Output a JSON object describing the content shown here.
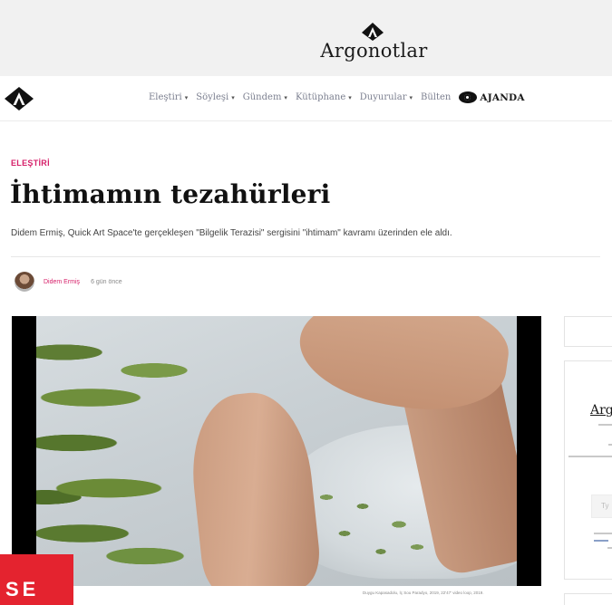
{
  "site": {
    "name": "Argonotlar"
  },
  "nav": {
    "items": [
      {
        "label": "Eleştiri",
        "caret": "▾"
      },
      {
        "label": "Söyleşi",
        "caret": "▾"
      },
      {
        "label": "Gündem",
        "caret": "▾"
      },
      {
        "label": "Kütüphane",
        "caret": "▾"
      },
      {
        "label": "Duyurular",
        "caret": "▾"
      },
      {
        "label": "Bülten",
        "caret": ""
      }
    ],
    "ajanda_label": "AJANDA",
    "icons": [
      "logo-icon",
      "eye-icon"
    ]
  },
  "article": {
    "category": "ELEŞTİRİ",
    "title": "İhtimamın tezahürleri",
    "subtitle": "Didem Ermiş, Quick Art Space'te gerçekleşen \"Bilgelik Terazisi\" sergisini \"ihtimam\" kavramı üzerinden ele aldı.",
    "author": "Didem Ermiş",
    "time_ago": "6 gün önce",
    "video_caption": "Duygu Kapasadolu, İç Sou Paradyo, 2019, 22'47' video loop, 2019."
  },
  "sidebar": {
    "title": "Arg",
    "input_placeholder": "Ty"
  },
  "badge": {
    "text": "SE"
  },
  "colors": {
    "accent": "#d61f69",
    "badge": "#e4232f",
    "banner_bg": "#f1f1f1"
  }
}
